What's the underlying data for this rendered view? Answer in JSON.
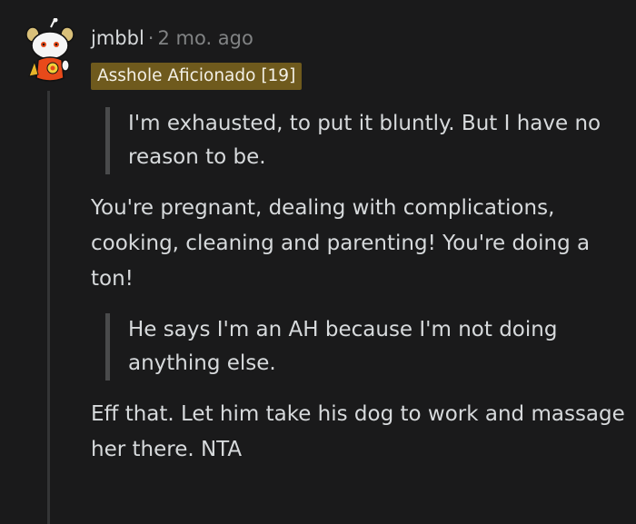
{
  "comment": {
    "username": "jmbbl",
    "separator": "·",
    "time": "2 mo. ago",
    "flair": "Asshole Aficionado [19]",
    "quote1": "I'm exhausted, to put it bluntly. But I have no reason to be.",
    "para1": "You're pregnant, dealing with complications, cooking, cleaning and parenting! You're doing a ton!",
    "quote2": "He says I'm an AH because I'm not doing anything else.",
    "para2": "Eff that. Let him take his dog to work and massage her there. NTA"
  },
  "colors": {
    "background": "#1a1a1b",
    "text": "#d7dadc",
    "muted": "#818384",
    "flair_bg": "#6f5a1d"
  },
  "icons": {
    "avatar": "snoo-avatar-icon"
  }
}
